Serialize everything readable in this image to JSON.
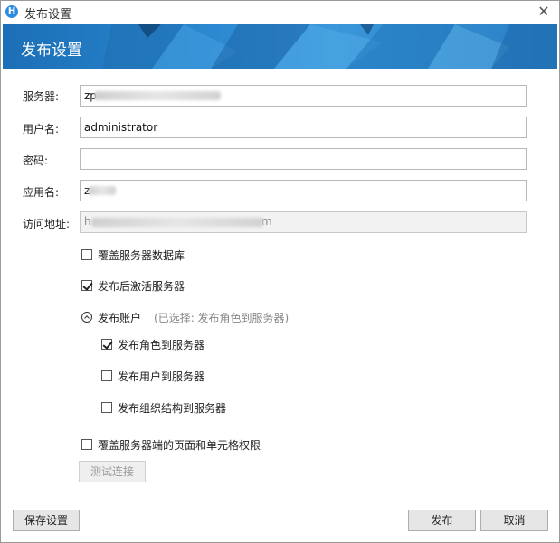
{
  "window": {
    "title": "发布设置",
    "logo_letter": "H",
    "close_glyph": "✕"
  },
  "banner": {
    "title": "发布设置"
  },
  "form": {
    "server": {
      "label": "服务器:",
      "value": "zp"
    },
    "username": {
      "label": "用户名:",
      "value": "administrator"
    },
    "password": {
      "label": "密码:",
      "value": ""
    },
    "appname": {
      "label": "应用名:",
      "value": "z"
    },
    "access_url": {
      "label": "访问地址:",
      "value_start": "h",
      "value_end": "m"
    }
  },
  "options": {
    "overwrite_db": {
      "label": "覆盖服务器数据库",
      "checked": false
    },
    "activate_after_publish": {
      "label": "发布后激活服务器",
      "checked": true
    },
    "publish_accounts": {
      "label": "发布账户",
      "hint": "(已选择: 发布角色到服务器)"
    },
    "publish_roles": {
      "label": "发布角色到服务器",
      "checked": true
    },
    "publish_users": {
      "label": "发布用户到服务器",
      "checked": false
    },
    "publish_org": {
      "label": "发布组织结构到服务器",
      "checked": false
    },
    "overwrite_perms": {
      "label": "覆盖服务器端的页面和单元格权限",
      "checked": false
    }
  },
  "buttons": {
    "test_connection": "测试连接",
    "save_settings": "保存设置",
    "publish": "发布",
    "cancel": "取消"
  },
  "colors": {
    "banner": "#2a86cf",
    "button_face": "#e6e6e6"
  }
}
